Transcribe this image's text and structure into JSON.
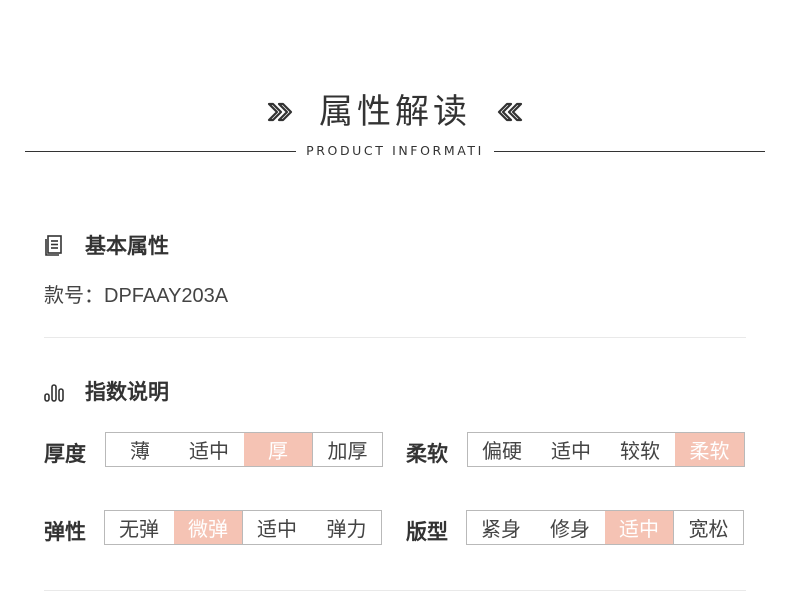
{
  "header": {
    "title": "属性解读",
    "subtitle": "PRODUCT INFORMATI",
    "ornament_left_icon": "double-chevron-right-icon",
    "ornament_right_icon": "double-chevron-left-icon"
  },
  "basic": {
    "heading": "基本属性",
    "icon": "document-list-icon",
    "style_no": "款号：DPFAAY203A"
  },
  "index": {
    "heading": "指数说明",
    "icon": "bar-chart-icon",
    "thickness": {
      "label": "厚度",
      "options": [
        "薄",
        "适中",
        "厚",
        "加厚"
      ],
      "selected": "厚"
    },
    "softness": {
      "label": "柔软",
      "options": [
        "偏硬",
        "适中",
        "较软",
        "柔软"
      ],
      "selected": "柔软"
    },
    "elasticity": {
      "label": "弹性",
      "options": [
        "无弹",
        "微弹",
        "适中",
        "弹力"
      ],
      "selected": "微弹"
    },
    "fit": {
      "label": "版型",
      "options": [
        "紧身",
        "修身",
        "适中",
        "宽松"
      ],
      "selected": "适中"
    }
  },
  "colors": {
    "accent": "#f5c3b4",
    "text": "#333333",
    "border": "#b9b9b9"
  }
}
